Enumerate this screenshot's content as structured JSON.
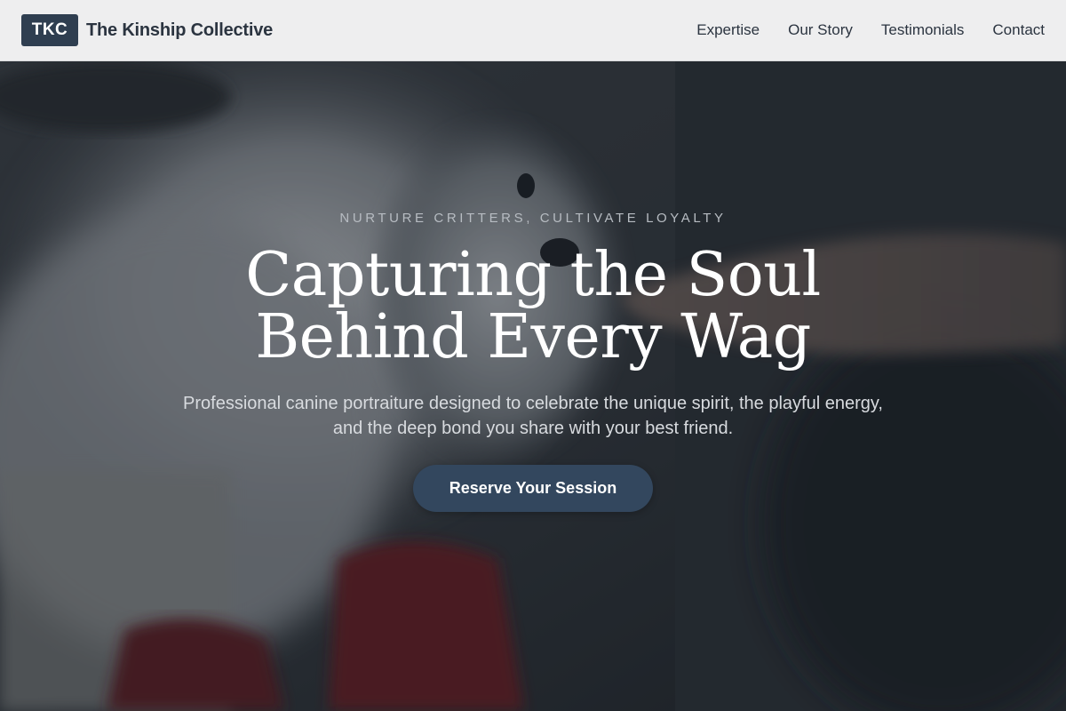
{
  "header": {
    "logo_text": "TKC",
    "brand_name": "The Kinship Collective",
    "nav": [
      {
        "label": "Expertise"
      },
      {
        "label": "Our Story"
      },
      {
        "label": "Testimonials"
      },
      {
        "label": "Contact"
      }
    ]
  },
  "hero": {
    "eyebrow": "NURTURE CRITTERS, CULTIVATE LOYALTY",
    "headline_line1": "Capturing the Soul",
    "headline_line2": "Behind Every Wag",
    "subhead_line1": "Professional canine portraiture designed to celebrate the unique spirit, the playful energy,",
    "subhead_line2": "and the deep bond you share with your best friend.",
    "cta_label": "Reserve Your Session"
  },
  "colors": {
    "brand_dark": "#2f3e50",
    "cta": "#33475e",
    "header_bg": "#eeeeef"
  }
}
